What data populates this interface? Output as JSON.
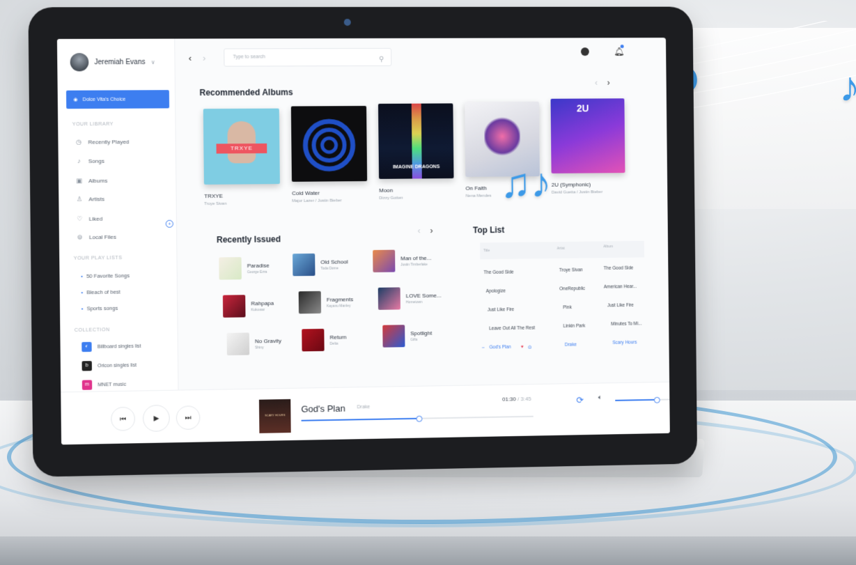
{
  "theme": {
    "accent": "#3d7ef0",
    "note_color": "#3d9ae8"
  },
  "user": {
    "name": "Jeremiah Evans"
  },
  "sidebar": {
    "choice_label": "Dolce Vita's Choice",
    "library_header": "YOUR LIBRARY",
    "library": [
      "Recently Played",
      "Songs",
      "Albums",
      "Artists",
      "Liked",
      "Local Files"
    ],
    "playlists_header": "YOUR PLAY LISTS",
    "playlists": [
      "50 Favorite Songs",
      "Bleach of best",
      "Sports songs"
    ],
    "collection_header": "COLLECTION",
    "collection": [
      "Billboard singles list",
      "Oricon singles list",
      "MNET music"
    ]
  },
  "search": {
    "placeholder": "Type to search"
  },
  "recommended": {
    "title": "Recommended Albums",
    "albums": [
      {
        "title": "TRXYE",
        "artist": "Troye Sivan",
        "cover_text": "TRXYE"
      },
      {
        "title": "Cold Water",
        "artist": "Major Lazer / Justin Bieber"
      },
      {
        "title": "Moon",
        "artist": "Dizzy Gotten",
        "cover_text": "IMAGINE DRAGONS"
      },
      {
        "title": "On Faith",
        "artist": "Nena Mendes"
      },
      {
        "title": "2U (Symphonic)",
        "artist": "David Guetta / Justin Bieber",
        "cover_text": "2U"
      }
    ]
  },
  "recent": {
    "title": "Recently Issued",
    "items": [
      {
        "title": "Paradise",
        "artist": "George Ezra"
      },
      {
        "title": "Old School",
        "artist": "Toda Dome"
      },
      {
        "title": "Man of the...",
        "artist": "Justin Timberlake"
      },
      {
        "title": "Rahpapa",
        "artist": "Kukuwar"
      },
      {
        "title": "Fragments",
        "artist": "Kayanu Manley"
      },
      {
        "title": "LOVE Some...",
        "artist": "Hometown"
      },
      {
        "title": "No Gravity",
        "artist": "Shiny"
      },
      {
        "title": "Return",
        "artist": "Delta"
      },
      {
        "title": "Spotlight",
        "artist": "Gifts"
      }
    ]
  },
  "toplist": {
    "title": "Top List",
    "columns": [
      "Title",
      "Artist",
      "Album"
    ],
    "rows": [
      [
        "The Good Side",
        "Troye Sivan",
        "The Good Side"
      ],
      [
        "Apologize",
        "OneRepublic",
        "American Hear..."
      ],
      [
        "Just Like Fire",
        "Pink",
        "Just Like Fire"
      ],
      [
        "Leave Out All The Rest",
        "Linkin Park",
        "Minutes To Mi..."
      ],
      [
        "God's Plan",
        "Drake",
        "Scary Hours"
      ]
    ]
  },
  "player": {
    "cover_text": "SCARY HOURS",
    "title": "God's Plan",
    "artist": "Drake",
    "elapsed": "01:30",
    "total": "3:45",
    "progress": 0.5,
    "volume": 0.6
  }
}
